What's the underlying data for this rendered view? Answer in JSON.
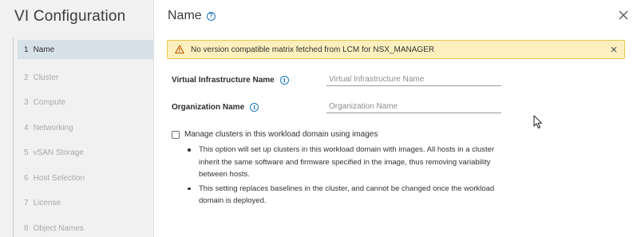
{
  "wizard": {
    "title": "VI Configuration",
    "steps": [
      {
        "num": "1",
        "label": "Name"
      },
      {
        "num": "2",
        "label": "Cluster"
      },
      {
        "num": "3",
        "label": "Compute"
      },
      {
        "num": "4",
        "label": "Networking"
      },
      {
        "num": "5",
        "label": "vSAN Storage"
      },
      {
        "num": "6",
        "label": "Host Selection"
      },
      {
        "num": "7",
        "label": "License"
      },
      {
        "num": "8",
        "label": "Object Names"
      }
    ],
    "active_step": "1"
  },
  "page": {
    "title": "Name",
    "help_icon": "help-circle-icon"
  },
  "alert": {
    "type": "warning",
    "message": "No version compatible matrix fetched from LCM for NSX_MANAGER",
    "color": "#fdf0be"
  },
  "form": {
    "vi_name": {
      "label": "Virtual Infrastructure Name",
      "placeholder": "Virtual Infrastructure Name",
      "value": ""
    },
    "org_name": {
      "label": "Organization Name",
      "placeholder": "Organization Name",
      "value": ""
    },
    "manage_images": {
      "label": "Manage clusters in this workload domain using images",
      "checked": false,
      "notes": [
        "This option will set up clusters in this workload domain with images. All hosts in a cluster inherit the same software and firmware specified in the image, thus removing variability between hosts.",
        "This setting replaces baselines in the cluster, and cannot be changed once the workload domain is deployed."
      ]
    }
  },
  "colors": {
    "accent": "#1c79c0",
    "sidebar_bg": "#f1f1f1",
    "active_step_bg": "#d7e1e8",
    "warning_border": "#e6c54f"
  }
}
